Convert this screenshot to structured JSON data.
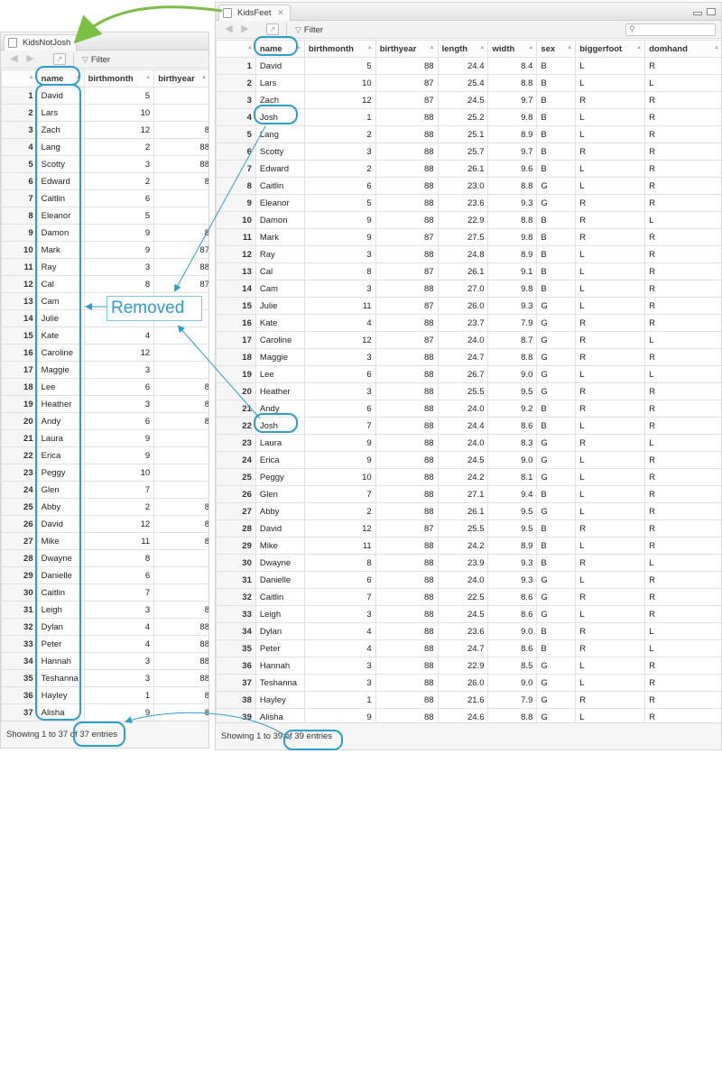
{
  "left": {
    "tab_title": "KidsNotJosh",
    "filter_label": "Filter",
    "columns": [
      "name",
      "birthmonth",
      "birthyear"
    ],
    "rows": [
      [
        "1",
        "David",
        "5",
        ""
      ],
      [
        "2",
        "Lars",
        "10",
        ""
      ],
      [
        "3",
        "Zach",
        "12",
        "8"
      ],
      [
        "4",
        "Lang",
        "2",
        "88"
      ],
      [
        "5",
        "Scotty",
        "3",
        "88"
      ],
      [
        "6",
        "Edward",
        "2",
        "8"
      ],
      [
        "7",
        "Caitlin",
        "6",
        ""
      ],
      [
        "8",
        "Eleanor",
        "5",
        ""
      ],
      [
        "9",
        "Damon",
        "9",
        "8"
      ],
      [
        "10",
        "Mark",
        "9",
        "87"
      ],
      [
        "11",
        "Ray",
        "3",
        "88"
      ],
      [
        "12",
        "Cal",
        "8",
        "87"
      ],
      [
        "13",
        "Cam",
        "3",
        ""
      ],
      [
        "14",
        "Julie",
        "",
        ""
      ],
      [
        "15",
        "Kate",
        "4",
        ""
      ],
      [
        "16",
        "Caroline",
        "12",
        ""
      ],
      [
        "17",
        "Maggie",
        "3",
        ""
      ],
      [
        "18",
        "Lee",
        "6",
        "8"
      ],
      [
        "19",
        "Heather",
        "3",
        "8"
      ],
      [
        "20",
        "Andy",
        "6",
        "8"
      ],
      [
        "21",
        "Laura",
        "9",
        ""
      ],
      [
        "22",
        "Erica",
        "9",
        ""
      ],
      [
        "23",
        "Peggy",
        "10",
        ""
      ],
      [
        "24",
        "Glen",
        "7",
        ""
      ],
      [
        "25",
        "Abby",
        "2",
        "8"
      ],
      [
        "26",
        "David",
        "12",
        "8"
      ],
      [
        "27",
        "Mike",
        "11",
        "8"
      ],
      [
        "28",
        "Dwayne",
        "8",
        ""
      ],
      [
        "29",
        "Danielle",
        "6",
        ""
      ],
      [
        "30",
        "Caitlin",
        "7",
        ""
      ],
      [
        "31",
        "Leigh",
        "3",
        "8"
      ],
      [
        "32",
        "Dylan",
        "4",
        "88"
      ],
      [
        "33",
        "Peter",
        "4",
        "88"
      ],
      [
        "34",
        "Hannah",
        "3",
        "88"
      ],
      [
        "35",
        "Teshanna",
        "3",
        "88"
      ],
      [
        "36",
        "Hayley",
        "1",
        "8"
      ],
      [
        "37",
        "Alisha",
        "9",
        "8"
      ]
    ],
    "status": "Showing 1 to 37 of 37 entries"
  },
  "right": {
    "tab_title": "KidsFeet",
    "filter_label": "Filter",
    "columns": [
      "name",
      "birthmonth",
      "birthyear",
      "length",
      "width",
      "sex",
      "biggerfoot",
      "domhand"
    ],
    "rows": [
      [
        "1",
        "David",
        "5",
        "88",
        "24.4",
        "8.4",
        "B",
        "L",
        "R"
      ],
      [
        "2",
        "Lars",
        "10",
        "87",
        "25.4",
        "8.8",
        "B",
        "L",
        "L"
      ],
      [
        "3",
        "Zach",
        "12",
        "87",
        "24.5",
        "9.7",
        "B",
        "R",
        "R"
      ],
      [
        "4",
        "Josh",
        "1",
        "88",
        "25.2",
        "9.8",
        "B",
        "L",
        "R"
      ],
      [
        "5",
        "Lang",
        "2",
        "88",
        "25.1",
        "8.9",
        "B",
        "L",
        "R"
      ],
      [
        "6",
        "Scotty",
        "3",
        "88",
        "25.7",
        "9.7",
        "B",
        "R",
        "R"
      ],
      [
        "7",
        "Edward",
        "2",
        "88",
        "26.1",
        "9.6",
        "B",
        "L",
        "R"
      ],
      [
        "8",
        "Caitlin",
        "6",
        "88",
        "23.0",
        "8.8",
        "G",
        "L",
        "R"
      ],
      [
        "9",
        "Eleanor",
        "5",
        "88",
        "23.6",
        "9.3",
        "G",
        "R",
        "R"
      ],
      [
        "10",
        "Damon",
        "9",
        "88",
        "22.9",
        "8.8",
        "B",
        "R",
        "L"
      ],
      [
        "11",
        "Mark",
        "9",
        "87",
        "27.5",
        "9.8",
        "B",
        "R",
        "R"
      ],
      [
        "12",
        "Ray",
        "3",
        "88",
        "24.8",
        "8.9",
        "B",
        "L",
        "R"
      ],
      [
        "13",
        "Cal",
        "8",
        "87",
        "26.1",
        "9.1",
        "B",
        "L",
        "R"
      ],
      [
        "14",
        "Cam",
        "3",
        "88",
        "27.0",
        "9.8",
        "B",
        "L",
        "R"
      ],
      [
        "15",
        "Julie",
        "11",
        "87",
        "26.0",
        "9.3",
        "G",
        "L",
        "R"
      ],
      [
        "16",
        "Kate",
        "4",
        "88",
        "23.7",
        "7.9",
        "G",
        "R",
        "R"
      ],
      [
        "17",
        "Caroline",
        "12",
        "87",
        "24.0",
        "8.7",
        "G",
        "R",
        "L"
      ],
      [
        "18",
        "Maggie",
        "3",
        "88",
        "24.7",
        "8.8",
        "G",
        "R",
        "R"
      ],
      [
        "19",
        "Lee",
        "6",
        "88",
        "26.7",
        "9.0",
        "G",
        "L",
        "L"
      ],
      [
        "20",
        "Heather",
        "3",
        "88",
        "25.5",
        "9.5",
        "G",
        "R",
        "R"
      ],
      [
        "21",
        "Andy",
        "6",
        "88",
        "24.0",
        "9.2",
        "B",
        "R",
        "R"
      ],
      [
        "22",
        "Josh",
        "7",
        "88",
        "24.4",
        "8.6",
        "B",
        "L",
        "R"
      ],
      [
        "23",
        "Laura",
        "9",
        "88",
        "24.0",
        "8.3",
        "G",
        "R",
        "L"
      ],
      [
        "24",
        "Erica",
        "9",
        "88",
        "24.5",
        "9.0",
        "G",
        "L",
        "R"
      ],
      [
        "25",
        "Peggy",
        "10",
        "88",
        "24.2",
        "8.1",
        "G",
        "L",
        "R"
      ],
      [
        "26",
        "Glen",
        "7",
        "88",
        "27.1",
        "9.4",
        "B",
        "L",
        "R"
      ],
      [
        "27",
        "Abby",
        "2",
        "88",
        "26.1",
        "9.5",
        "G",
        "L",
        "R"
      ],
      [
        "28",
        "David",
        "12",
        "87",
        "25.5",
        "9.5",
        "B",
        "R",
        "R"
      ],
      [
        "29",
        "Mike",
        "11",
        "88",
        "24.2",
        "8.9",
        "B",
        "L",
        "R"
      ],
      [
        "30",
        "Dwayne",
        "8",
        "88",
        "23.9",
        "9.3",
        "B",
        "R",
        "L"
      ],
      [
        "31",
        "Danielle",
        "6",
        "88",
        "24.0",
        "9.3",
        "G",
        "L",
        "R"
      ],
      [
        "32",
        "Caitlin",
        "7",
        "88",
        "22.5",
        "8.6",
        "G",
        "R",
        "R"
      ],
      [
        "33",
        "Leigh",
        "3",
        "88",
        "24.5",
        "8.6",
        "G",
        "L",
        "R"
      ],
      [
        "34",
        "Dylan",
        "4",
        "88",
        "23.6",
        "9.0",
        "B",
        "R",
        "L"
      ],
      [
        "35",
        "Peter",
        "4",
        "88",
        "24.7",
        "8.6",
        "B",
        "R",
        "L"
      ],
      [
        "36",
        "Hannah",
        "3",
        "88",
        "22.9",
        "8.5",
        "G",
        "L",
        "R"
      ],
      [
        "37",
        "Teshanna",
        "3",
        "88",
        "26.0",
        "9.0",
        "G",
        "L",
        "R"
      ],
      [
        "38",
        "Hayley",
        "1",
        "88",
        "21.6",
        "7.9",
        "G",
        "R",
        "R"
      ],
      [
        "39",
        "Alisha",
        "9",
        "88",
        "24.6",
        "8.8",
        "G",
        "L",
        "R"
      ]
    ],
    "status": "Showing 1 to 39 of 39 entries"
  },
  "annotation": {
    "removed_label": "Removed",
    "annotation_color": "#2b9fcf",
    "arrow_color": "#7cc043"
  },
  "icons": [
    "doc-icon",
    "close-icon",
    "back-arrow-icon",
    "forward-arrow-icon",
    "go-to-icon",
    "filter-icon",
    "search-icon",
    "sort-icon"
  ]
}
